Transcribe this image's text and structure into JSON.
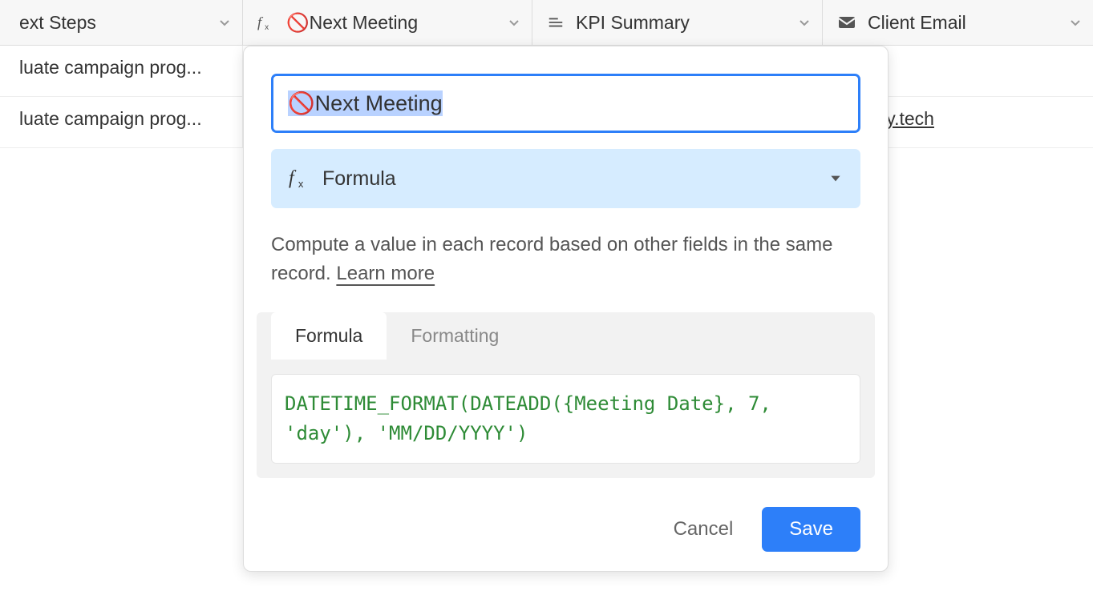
{
  "columns": [
    {
      "id": "next_steps",
      "label": "ext Steps",
      "icon": "text-icon"
    },
    {
      "id": "next_meeting",
      "label": "🚫Next Meeting",
      "icon": "formula-icon"
    },
    {
      "id": "kpi_summary",
      "label": "KPI Summary",
      "icon": "long-text-icon"
    },
    {
      "id": "client_email",
      "label": "Client Email",
      "icon": "email-icon"
    }
  ],
  "rows": [
    {
      "next_steps": "luate campaign prog...",
      "next_meeting": "",
      "kpi_summary": "",
      "client_email": ""
    },
    {
      "next_steps": "luate campaign prog...",
      "next_meeting": "",
      "kpi_summary": "",
      "client_email": "@xray.tech"
    }
  ],
  "dialog": {
    "field_name_value": "🚫Next Meeting",
    "field_type": {
      "label": "Formula",
      "description": "Compute a value in each record based on other fields in the same record. ",
      "learn_more": "Learn more"
    },
    "tabs": {
      "formula": "Formula",
      "formatting": "Formatting",
      "active": "formula"
    },
    "formula_text": "DATETIME_FORMAT(DATEADD({Meeting Date}, 7, 'day'), 'MM/DD/YYYY')",
    "actions": {
      "cancel": "Cancel",
      "save": "Save"
    }
  }
}
